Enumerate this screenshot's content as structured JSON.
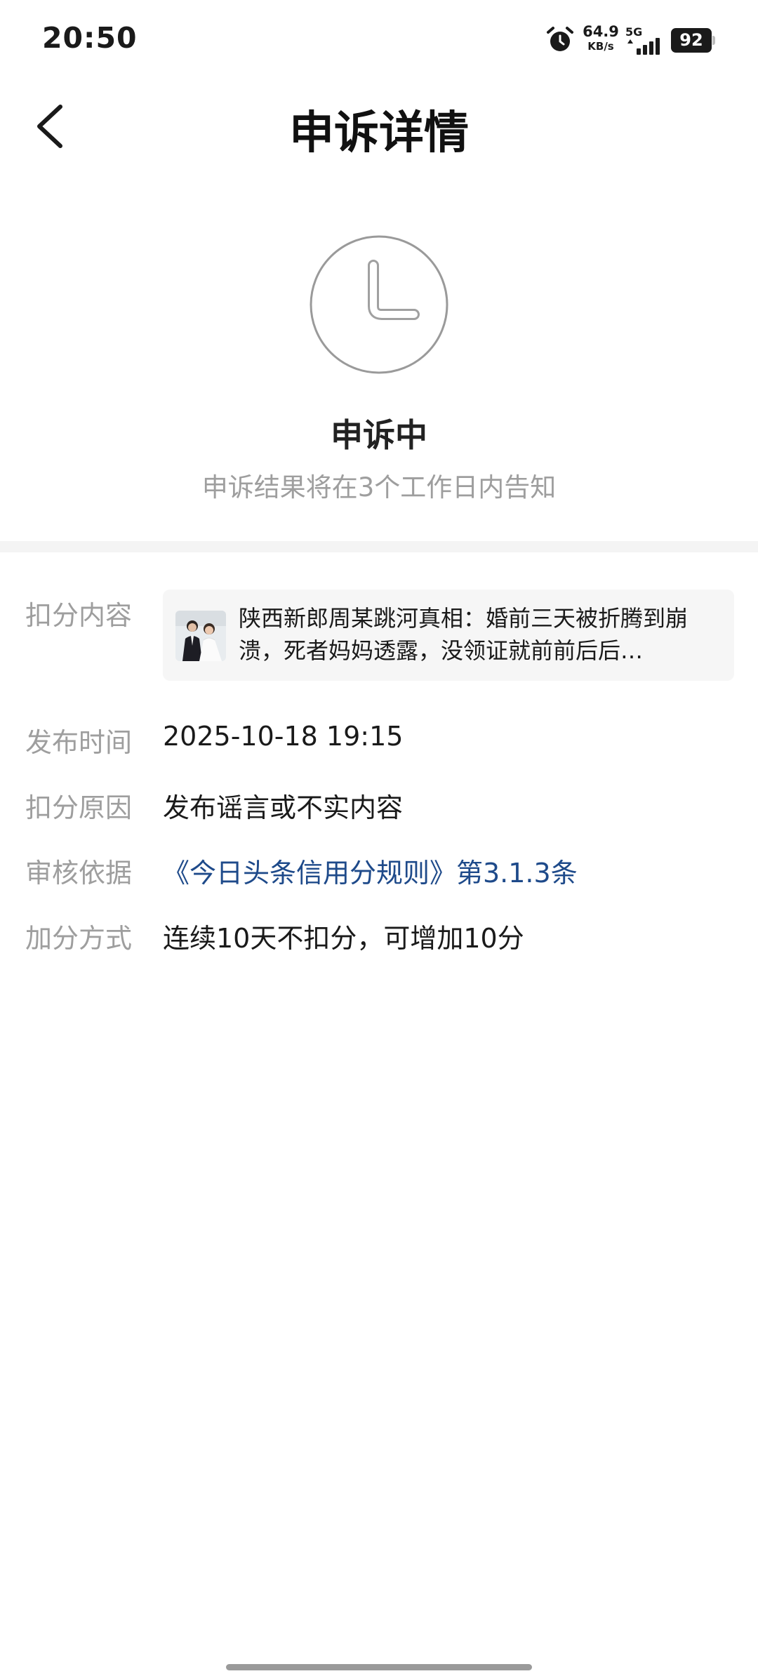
{
  "status_bar": {
    "time": "20:50",
    "net_speed_value": "64.9",
    "net_speed_unit": "KB/s",
    "network_type": "5G",
    "battery": "92",
    "icons": [
      "alarm-clock-icon",
      "signal-icon",
      "battery-icon"
    ]
  },
  "header": {
    "title": "申诉详情",
    "back_icon": "chevron-left-icon"
  },
  "appeal_status": {
    "icon": "clock-icon",
    "title": "申诉中",
    "subtitle": "申诉结果将在3个工作日内告知"
  },
  "details": {
    "content": {
      "label": "扣分内容",
      "article_text": "陕西新郎周某跳河真相：婚前三天被折腾到崩溃，死者妈妈透露，没领证就前前后后…",
      "thumbnail": "wedding-photo-thumbnail"
    },
    "publish_time": {
      "label": "发布时间",
      "value": "2025-10-18 19:15"
    },
    "reason": {
      "label": "扣分原因",
      "value": "发布谣言或不实内容"
    },
    "basis": {
      "label": "审核依据",
      "value": "《今日头条信用分规则》第3.1.3条"
    },
    "bonus_method": {
      "label": "加分方式",
      "value": "连续10天不扣分，可增加10分"
    }
  },
  "colors": {
    "link": "#1e4a8a",
    "label_gray": "#9e9e9e",
    "text": "#1a1a1a",
    "divider": "#f4f4f4",
    "card_bg": "#f6f6f6"
  }
}
